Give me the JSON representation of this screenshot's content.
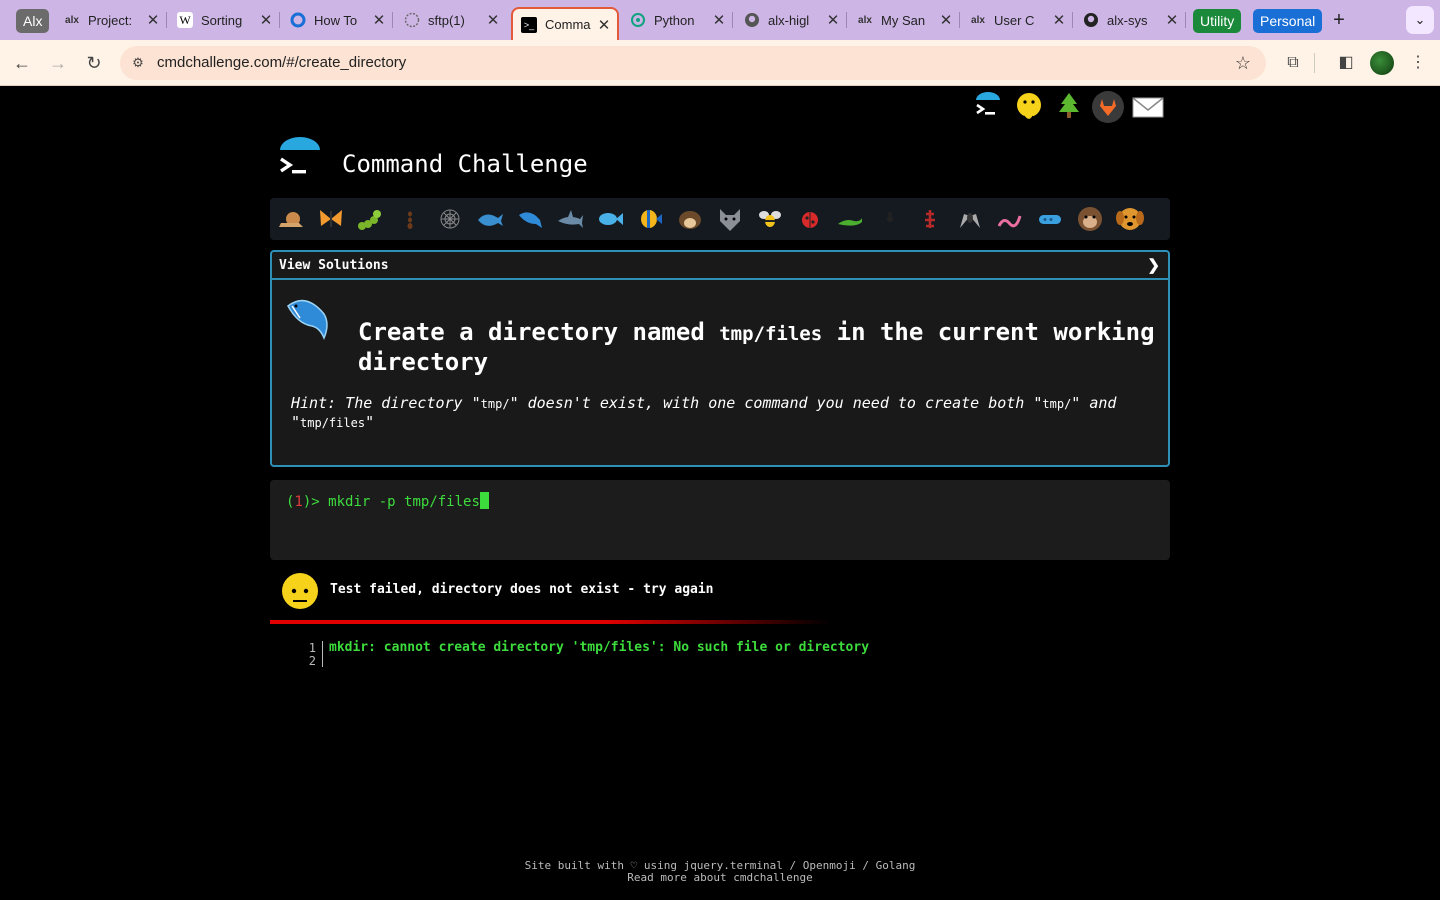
{
  "browser": {
    "group_chips": [
      {
        "label": "Alx",
        "color": "#6b6b6b"
      },
      {
        "label": "Utility",
        "color": "#1a8a3a"
      },
      {
        "label": "Personal",
        "color": "#1a6fd6"
      }
    ],
    "tabs": [
      {
        "title": "Project:",
        "icon": "alx-icon"
      },
      {
        "title": "Sorting",
        "icon": "wikipedia-icon"
      },
      {
        "title": "How To",
        "icon": "digitalocean-icon"
      },
      {
        "title": "sftp(1)",
        "icon": "globe-icon"
      },
      {
        "title": "Comma",
        "icon": "terminal-icon",
        "active": true
      },
      {
        "title": "Python",
        "icon": "openai-icon"
      },
      {
        "title": "alx-higl",
        "icon": "github-icon"
      },
      {
        "title": "My San",
        "icon": "alx-icon"
      },
      {
        "title": "User C",
        "icon": "alx-icon"
      },
      {
        "title": "alx-sys",
        "icon": "github-icon"
      }
    ],
    "url": "cmdchallenge.com/#/create_directory"
  },
  "site": {
    "title": "Command Challenge",
    "top_icons": [
      "terminal-logo-icon",
      "yellow-face-icon",
      "tree-icon",
      "gitlab-icon",
      "envelope-icon"
    ],
    "critters": [
      "snail",
      "butterfly",
      "caterpillar",
      "ant",
      "spider-web",
      "whale",
      "dolphin",
      "shark",
      "fish",
      "tropical-fish",
      "hedgehog",
      "wolf",
      "bee",
      "ladybug",
      "lizard",
      "spider",
      "scorpion",
      "fly",
      "worm",
      "microbe",
      "monkey",
      "dog"
    ]
  },
  "challenge": {
    "view_solutions": "View Solutions",
    "chevron": "❯",
    "title_part1": "Create a directory named ",
    "title_code": "tmp/files",
    "title_part2": " in the current working directory",
    "hint_part1": "Hint: The directory \"",
    "hint_code1": "tmp/",
    "hint_part2": "\" doesn't exist, with one command you need to create both \"",
    "hint_code2": "tmp/",
    "hint_part3": "\" and \"",
    "hint_code3": "tmp/files",
    "hint_part4": "\""
  },
  "terminal": {
    "prompt_open": "(",
    "prompt_num": "1",
    "prompt_close": ")> ",
    "command": "mkdir -p tmp/files"
  },
  "result": {
    "message": "Test failed, directory does not exist - try again",
    "status_color": "#e00000",
    "output_lines": [
      "1",
      "2"
    ],
    "output_text": "mkdir: cannot create directory 'tmp/files': No such file or directory"
  },
  "footer": {
    "line1": "Site built with ♡ using jquery.terminal / Openmoji / Golang",
    "line2": "Read more about cmdchallenge"
  }
}
